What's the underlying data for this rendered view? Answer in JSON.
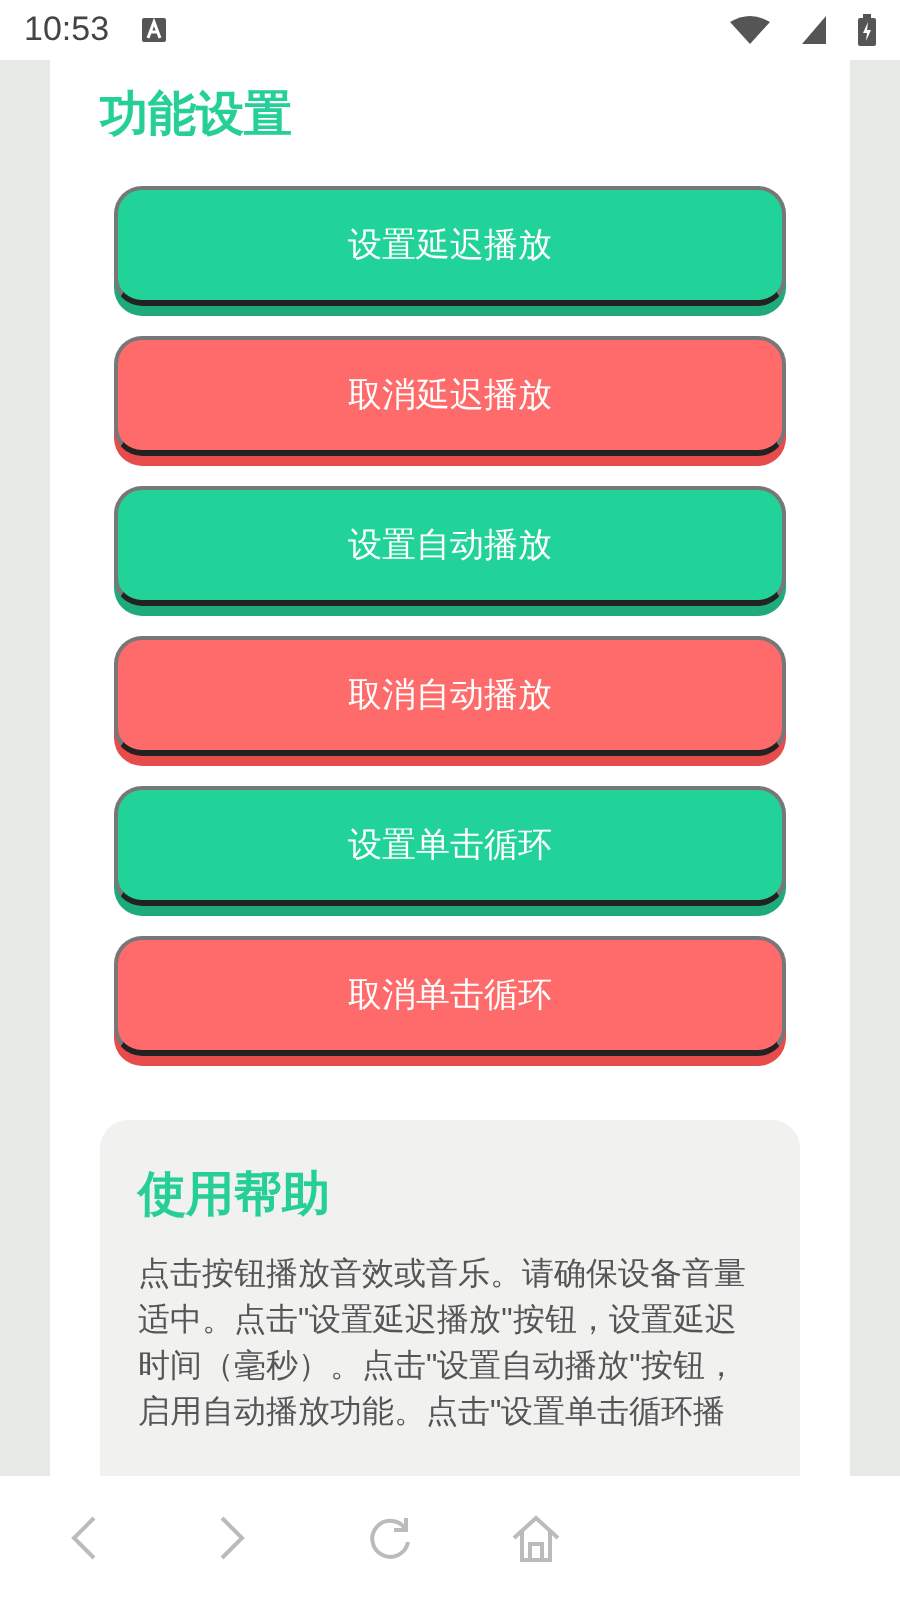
{
  "status_bar": {
    "time": "10:53"
  },
  "section_title": "功能设置",
  "buttons": [
    {
      "label": "设置延迟播放",
      "kind": "set"
    },
    {
      "label": "取消延迟播放",
      "kind": "cancel"
    },
    {
      "label": "设置自动播放",
      "kind": "set"
    },
    {
      "label": "取消自动播放",
      "kind": "cancel"
    },
    {
      "label": "设置单击循环",
      "kind": "set"
    },
    {
      "label": "取消单击循环",
      "kind": "cancel"
    }
  ],
  "help": {
    "title": "使用帮助",
    "text": "点击按钮播放音效或音乐。请确保设备音量适中。点击\"设置延迟播放\"按钮，设置延迟时间（毫秒）。点击\"设置自动播放\"按钮，启用自动播放功能。点击\"设置单击循环播"
  }
}
